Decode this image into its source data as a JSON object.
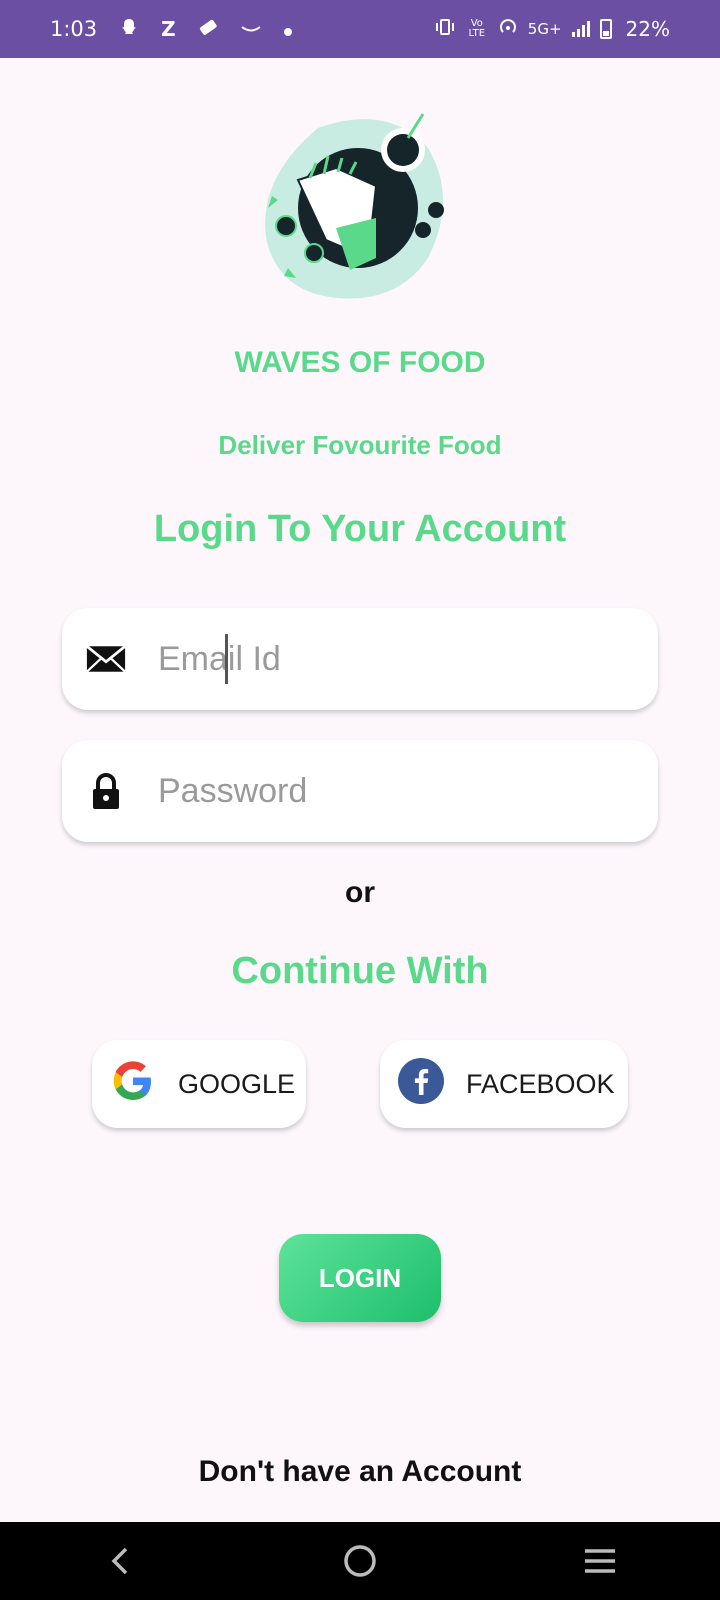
{
  "status_bar": {
    "time": "1:03",
    "icons_left": [
      "snapchat-icon",
      "z-icon",
      "ticket-icon",
      "amazon-icon",
      "dot-icon"
    ],
    "z_label": "Z",
    "network": "5G+",
    "volte": "Vo LTE",
    "battery": "22%"
  },
  "app": {
    "brand": "WAVES OF FOOD",
    "tagline": "Deliver Fovourite Food",
    "heading": "Login To Your Account"
  },
  "form": {
    "email_placeholder": "Email Id",
    "password_placeholder": "Password"
  },
  "divider_text": "or",
  "continue_with": "Continue With",
  "social": {
    "google_label": "GOOGLE",
    "facebook_label": "FACEBOOK"
  },
  "login_label": "LOGIN",
  "signup_text": "Don't have an Account",
  "colors": {
    "accent": "#5ad98a",
    "status_bar": "#6a4fa3",
    "background": "#fdf7fc",
    "facebook": "#3b5998"
  }
}
